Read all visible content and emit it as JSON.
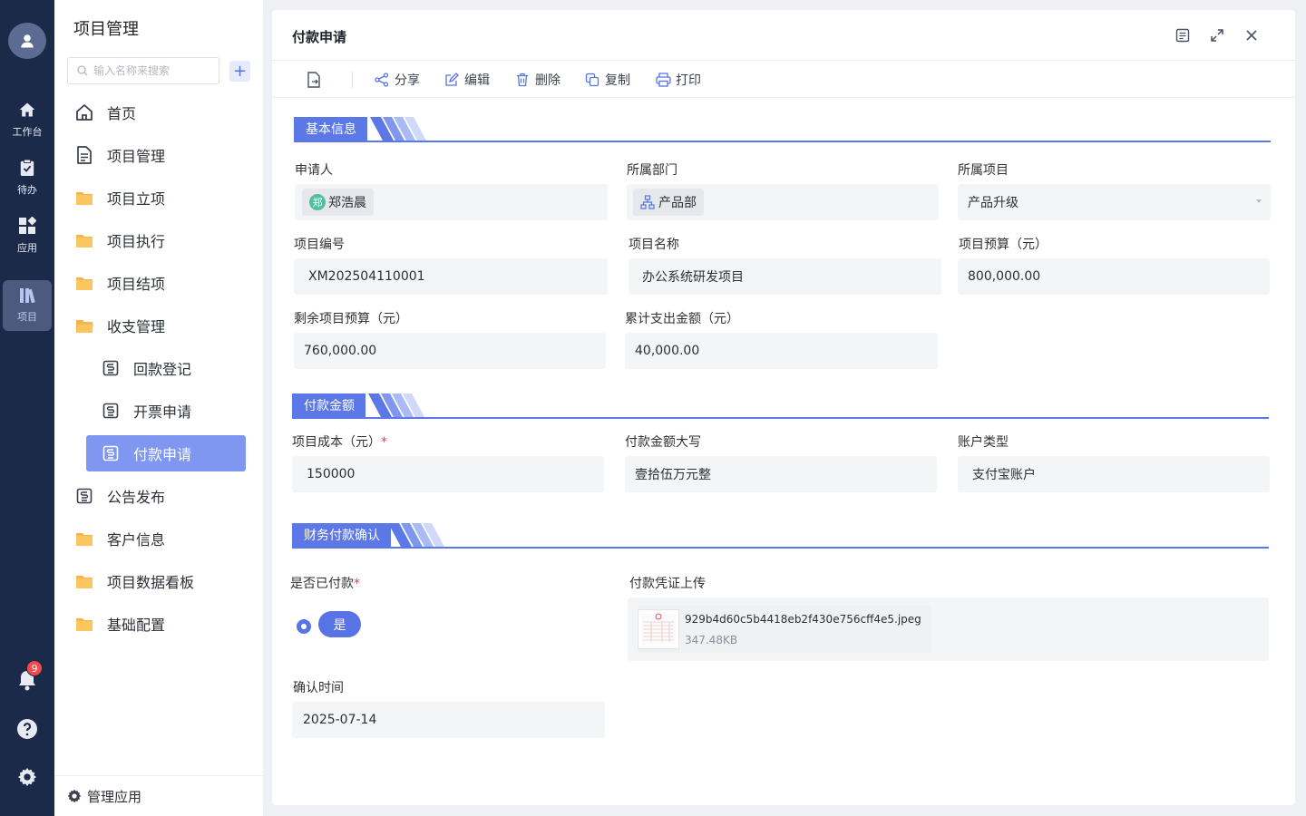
{
  "rail": {
    "items": [
      {
        "label": "工作台",
        "icon": "home-icon"
      },
      {
        "label": "待办",
        "icon": "clipboard-check-icon"
      },
      {
        "label": "应用",
        "icon": "apps-grid-icon"
      },
      {
        "label": "项目",
        "icon": "books-icon"
      }
    ],
    "notification_count": "9"
  },
  "sidebar": {
    "title": "项目管理",
    "search_placeholder": "输入名称来搜索",
    "add_label": "+",
    "items": [
      {
        "label": "首页"
      },
      {
        "label": "项目管理"
      },
      {
        "label": "项目立项"
      },
      {
        "label": "项目执行"
      },
      {
        "label": "项目结项"
      },
      {
        "label": "收支管理"
      },
      {
        "label": "回款登记"
      },
      {
        "label": "开票申请"
      },
      {
        "label": "付款申请"
      },
      {
        "label": "公告发布"
      },
      {
        "label": "客户信息"
      },
      {
        "label": "项目数据看板"
      },
      {
        "label": "基础配置"
      }
    ],
    "footer_label": "管理应用"
  },
  "panel": {
    "title": "付款申请",
    "toolbar": {
      "share": "分享",
      "edit": "编辑",
      "delete": "删除",
      "copy": "复制",
      "print": "打印"
    }
  },
  "sections": {
    "basic": "基本信息",
    "payment": "付款金额",
    "finance": "财务付款确认"
  },
  "fields": {
    "applicant": {
      "label": "申请人",
      "value": "郑浩晨",
      "avatar_char": "郑"
    },
    "department": {
      "label": "所属部门",
      "value": "产品部"
    },
    "project": {
      "label": "所属项目",
      "value": "产品升级"
    },
    "project_no": {
      "label": "项目编号",
      "value": "XM202504110001"
    },
    "project_name": {
      "label": "项目名称",
      "value": "办公系统研发项目"
    },
    "budget": {
      "label": "项目预算（元）",
      "value": "800,000.00"
    },
    "remaining": {
      "label": "剩余项目预算（元）",
      "value": "760,000.00"
    },
    "spent": {
      "label": "累计支出金额（元）",
      "value": "40,000.00"
    },
    "cost": {
      "label": "项目成本（元）",
      "required_mark": "*",
      "value": "150000"
    },
    "amount_upper": {
      "label": "付款金额大写",
      "value": "壹拾伍万元整"
    },
    "account_type": {
      "label": "账户类型",
      "value": "支付宝账户"
    },
    "paid": {
      "label": "是否已付款",
      "required_mark": "*",
      "value": "是"
    },
    "voucher": {
      "label": "付款凭证上传",
      "file_name": "929b4d60c5b4418eb2f430e756cff4e5.jpeg",
      "file_size": "347.48KB"
    },
    "confirm_time": {
      "label": "确认时间",
      "value": "2025-07-14"
    }
  },
  "colors": {
    "rail_bg": "#1c2a4a",
    "accent": "#5873e6",
    "active_menu": "#8097f2",
    "required": "#f23d3d"
  }
}
